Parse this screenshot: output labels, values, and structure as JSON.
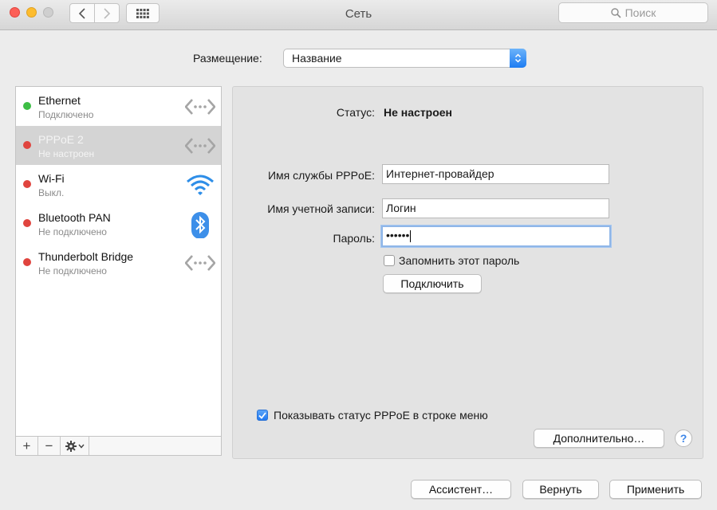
{
  "window": {
    "title": "Сеть"
  },
  "search": {
    "placeholder": "Поиск"
  },
  "location": {
    "label": "Размещение:",
    "value": "Название"
  },
  "services": [
    {
      "name": "Ethernet",
      "status": "Подключено",
      "status_color": "#3dbe45",
      "icon": "ethernet-arrows-icon"
    },
    {
      "name": "PPPoE 2",
      "status": "Не настроен",
      "status_color": "#e0443e",
      "icon": "ethernet-arrows-icon",
      "selected": true
    },
    {
      "name": "Wi-Fi",
      "status": "Выкл.",
      "status_color": "#e0443e",
      "icon": "wifi-icon"
    },
    {
      "name": "Bluetooth PAN",
      "status": "Не подключено",
      "status_color": "#e0443e",
      "icon": "bluetooth-icon"
    },
    {
      "name": "Thunderbolt Bridge",
      "status": "Не подключено",
      "status_color": "#e0443e",
      "icon": "ethernet-arrows-icon"
    }
  ],
  "sidebar_controls": {
    "add": "+",
    "remove": "−"
  },
  "detail": {
    "status_label": "Статус:",
    "status_value": "Не настроен",
    "service_name_label": "Имя службы PPPoE:",
    "service_name_value": "Интернет-провайдер",
    "account_label": "Имя учетной записи:",
    "account_value": "Логин",
    "password_label": "Пароль:",
    "password_value": "••••••",
    "remember_label": "Запомнить этот пароль",
    "remember_checked": false,
    "connect_button": "Подключить",
    "show_status_label": "Показывать статус PPPoE в строке меню",
    "show_status_checked": true,
    "advanced_button": "Дополнительно…",
    "help": "?"
  },
  "footer": {
    "assistant": "Ассистент…",
    "revert": "Вернуть",
    "apply": "Применить"
  },
  "colors": {
    "accent": "#2179f1",
    "selected_row": "#d4d4d4"
  }
}
